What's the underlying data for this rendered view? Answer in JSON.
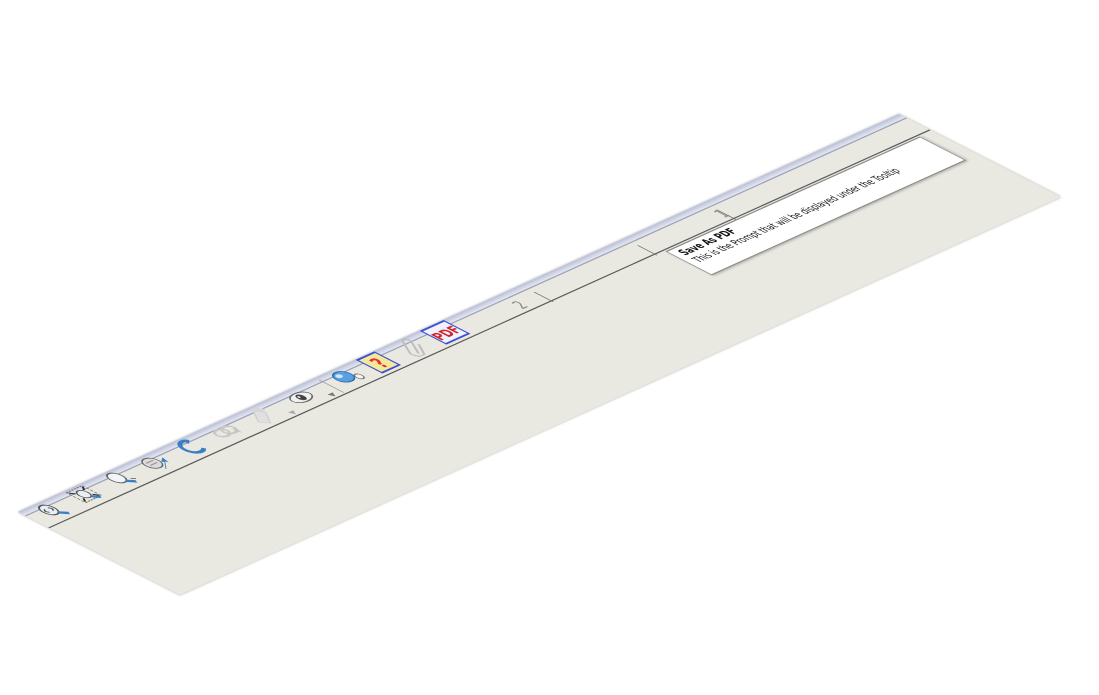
{
  "toolbar": {
    "buttons": [
      {
        "name": "zoom-fit-page-button",
        "icon": "zoom-arrows-icon",
        "disabled": false
      },
      {
        "name": "zoom-fit-width-button",
        "icon": "zoom-expand-icon",
        "disabled": false
      },
      {
        "name": "zoom-in-button",
        "icon": "magnifier-icon",
        "disabled": false
      },
      {
        "name": "pan-tool-button",
        "icon": "pan-arrow-icon",
        "disabled": false
      },
      {
        "name": "rotate-button",
        "icon": "rotate-arrow-icon",
        "disabled": false
      },
      {
        "name": "link-button",
        "icon": "link-chain-icon",
        "disabled": true
      },
      {
        "name": "highlight-button",
        "icon": "highlighter-icon",
        "disabled": true
      },
      {
        "name": "view-button",
        "icon": "eye-icon",
        "disabled": false
      },
      {
        "name": "comment-button",
        "icon": "comment-bubble-icon",
        "disabled": false
      },
      {
        "name": "help-button",
        "icon": "question-mark-icon",
        "disabled": false
      },
      {
        "name": "attach-button",
        "icon": "paperclip-icon",
        "disabled": true
      },
      {
        "name": "save-as-pdf-button",
        "icon": "pdf-icon",
        "disabled": false
      }
    ],
    "pdf_label": "PDF",
    "help_label": "?"
  },
  "ruler": {
    "marks": [
      "2",
      "1"
    ]
  },
  "tooltip": {
    "title": "Save As PDF",
    "body": "This is the Prompt that will be displayed under the Tooltip"
  },
  "colors": {
    "strip": "#e9e9e1",
    "rail": "#b9bfd8",
    "accent_blue": "#3a7fc4",
    "pdf_red": "#d0262b",
    "help_red": "#e03030",
    "help_bg": "#f4e89a"
  }
}
